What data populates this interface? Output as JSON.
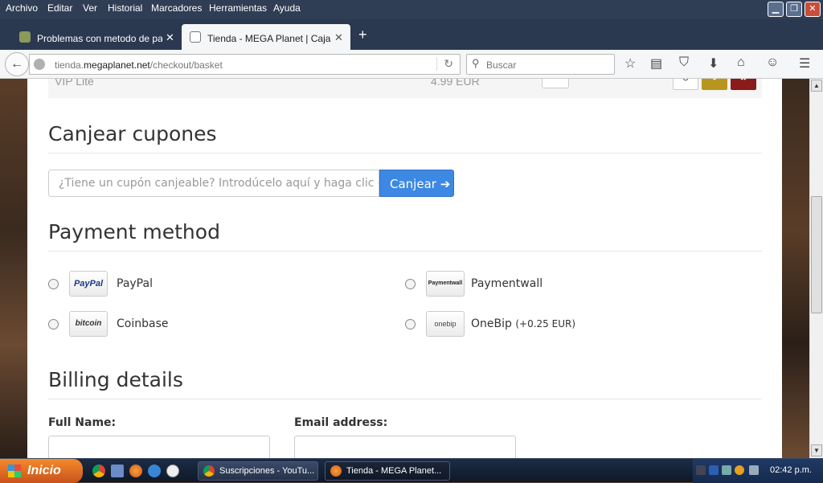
{
  "menu": [
    "Archivo",
    "Editar",
    "Ver",
    "Historial",
    "Marcadores",
    "Herramientas",
    "Ayuda"
  ],
  "tabs": [
    {
      "label": "Problemas con metodo de pag…",
      "active": false
    },
    {
      "label": "Tienda - MEGA Planet | Caja",
      "active": true
    }
  ],
  "url": {
    "prefix": "tienda.",
    "host": "megaplanet.net",
    "path": "/checkout/basket"
  },
  "search_placeholder": "Buscar",
  "basket_row": {
    "item": "VIP Lite",
    "price": "4.99 EUR"
  },
  "coupons": {
    "title": "Canjear cupones",
    "placeholder": "¿Tiene un cupón canjeable? Introdúcelo aquí y haga clic e",
    "button": "Canjear ➔"
  },
  "payment": {
    "title": "Payment method",
    "methods": [
      {
        "name": "PayPal",
        "logo": "PayPal",
        "fee": ""
      },
      {
        "name": "Paymentwall",
        "logo": "Paymentwall",
        "fee": ""
      },
      {
        "name": "Coinbase",
        "logo": "bitcoin",
        "fee": ""
      },
      {
        "name": "OneBip",
        "logo": "onebip",
        "fee": "(+0.25 EUR)"
      }
    ]
  },
  "billing": {
    "title": "Billing details",
    "full_name_label": "Full Name:",
    "email_label": "Email address:"
  },
  "taskbar": {
    "start": "Inicio",
    "tasks": [
      "Suscripciones - YouTu...",
      "Tienda - MEGA Planet..."
    ],
    "clock": "02:42 p.m."
  },
  "colors": {
    "accent": "#3d88e3",
    "start": "#e8702a"
  }
}
